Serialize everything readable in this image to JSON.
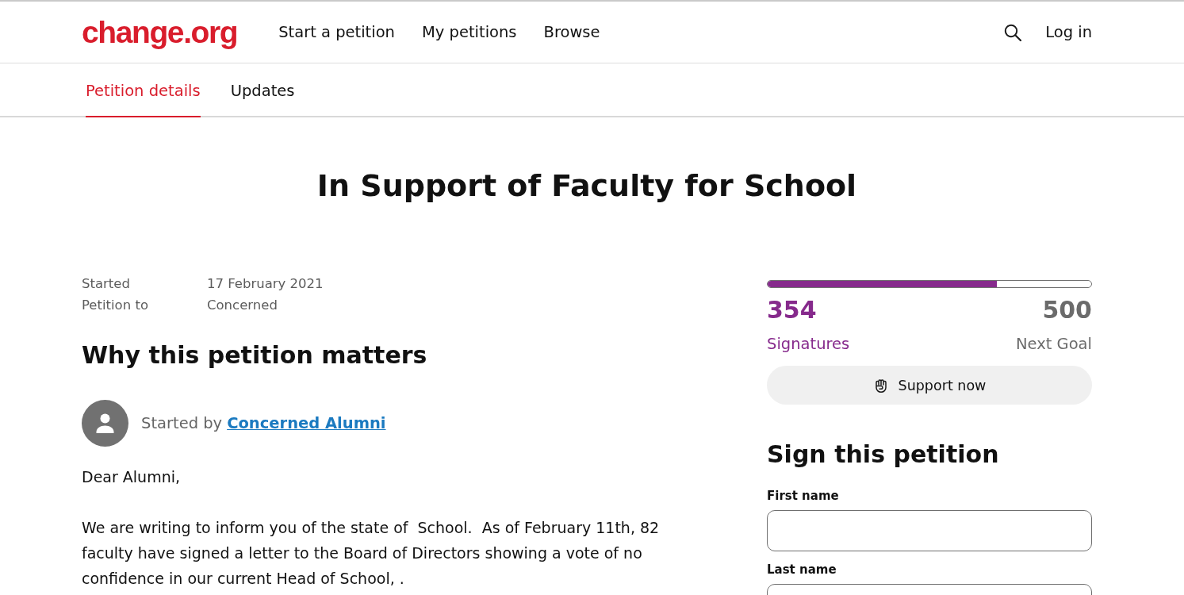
{
  "header": {
    "logo": "change.org",
    "nav": [
      {
        "label": "Start a petition"
      },
      {
        "label": "My petitions"
      },
      {
        "label": "Browse"
      }
    ],
    "login": "Log in"
  },
  "tabs": [
    {
      "label": "Petition details",
      "selected": true
    },
    {
      "label": "Updates",
      "selected": false
    }
  ],
  "title": "In Support of Faculty for School",
  "meta": [
    {
      "label": "Started",
      "value": "17 February 2021"
    },
    {
      "label": "Petition to",
      "value": "Concerned"
    }
  ],
  "story": {
    "heading": "Why this petition matters",
    "started_by": "Started by",
    "author": "Concerned Alumni",
    "paragraphs": [
      "Dear Alumni,",
      "We are writing to inform you of the state of  School.  As of February 11th, 82 faculty have signed a letter to the Board of Directors showing a vote of no confidence in our current Head of School, ."
    ]
  },
  "progress": {
    "level": 0.708,
    "count": "354",
    "count_label": "Signatures",
    "goal": "500",
    "goal_label": "Next Goal",
    "button": "Support now"
  },
  "sign_form": {
    "heading": "Sign this petition",
    "fields": [
      {
        "label": "First name"
      },
      {
        "label": "Last name"
      }
    ]
  }
}
